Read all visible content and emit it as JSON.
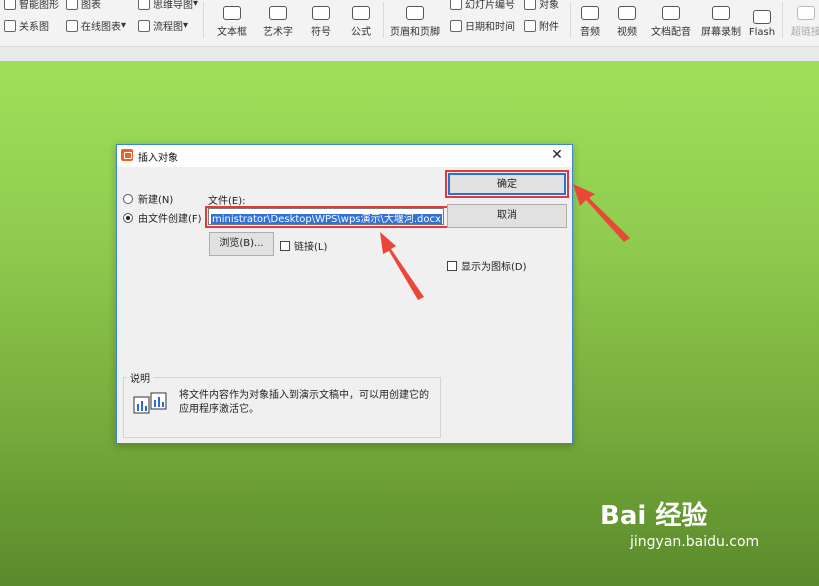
{
  "ribbon": {
    "row1": [
      "智能图形",
      "图表",
      "思维导图",
      "幻灯片编号",
      "对象"
    ],
    "row2": [
      "关系图",
      "在线图表",
      "流程图",
      "日期和时间",
      "附件"
    ],
    "big": [
      "文本框",
      "艺术字",
      "符号",
      "公式",
      "页眉和页脚",
      "音频",
      "视频",
      "文档配音",
      "屏幕录制",
      "Flash",
      "超链接"
    ]
  },
  "dialog": {
    "title": "插入对象",
    "close_glyph": "✕",
    "radio_new": "新建(N)",
    "radio_from_file": "由文件创建(F)",
    "file_label": "文件(E):",
    "file_value": "ministrator\\Desktop\\WPS\\wps演示\\大堰河.docx",
    "ok": "确定",
    "cancel": "取消",
    "browse": "浏览(B)...",
    "link": "链接(L)",
    "show_as_icon": "显示为图标(D)",
    "desc_title": "说明",
    "desc_text": "将文件内容作为对象插入到演示文稿中，可以用创建它的应用程序激活它。"
  },
  "watermark": {
    "logo": "Bai  经验",
    "url": "jingyan.baidu.com"
  },
  "colors": {
    "highlight": "#e23a3a",
    "accent": "#2f6fd0",
    "slide_top": "#9fe05a",
    "slide_bottom": "#5a8a2b"
  }
}
